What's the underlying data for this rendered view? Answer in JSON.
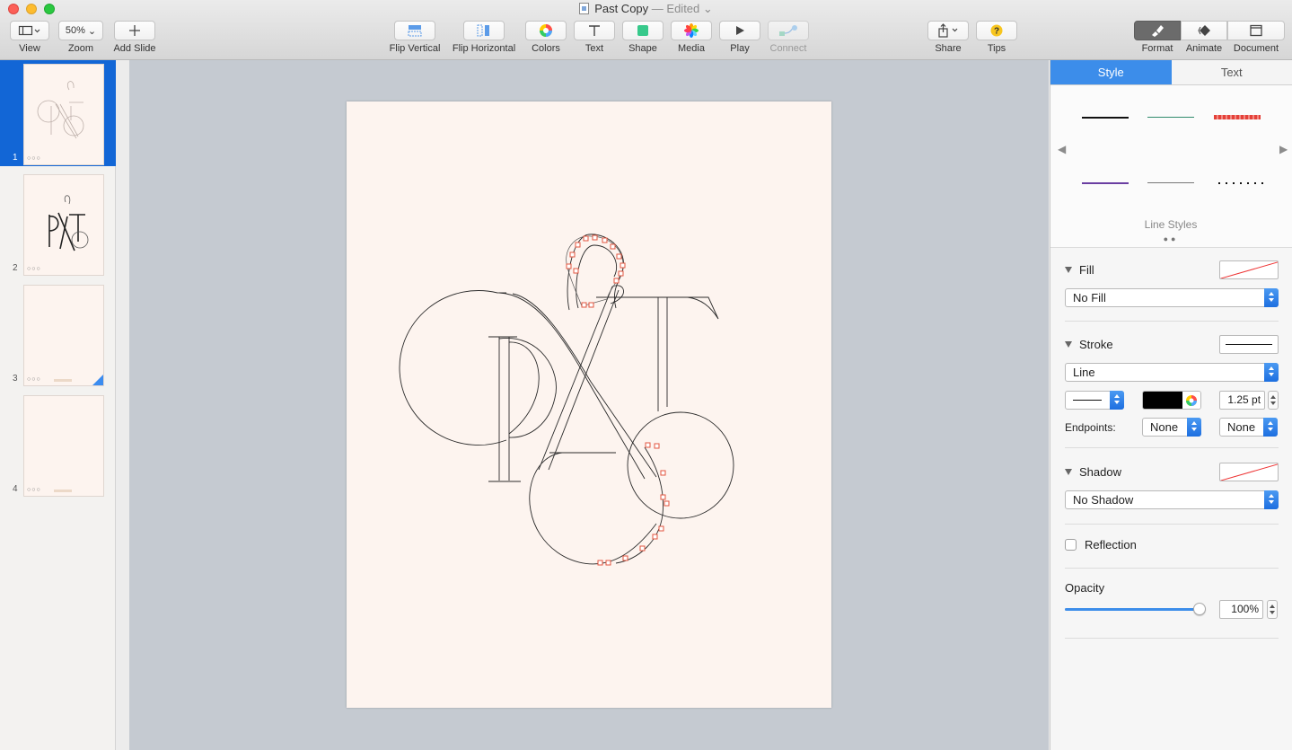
{
  "window": {
    "title": "Past Copy",
    "status": "— Edited"
  },
  "toolbar": {
    "view_label": "View",
    "zoom_value": "50%",
    "zoom_label": "Zoom",
    "add_slide_label": "Add Slide",
    "flip_vertical_label": "Flip Vertical",
    "flip_horizontal_label": "Flip Horizontal",
    "colors_label": "Colors",
    "text_label": "Text",
    "shape_label": "Shape",
    "media_label": "Media",
    "play_label": "Play",
    "connect_label": "Connect",
    "share_label": "Share",
    "tips_label": "Tips",
    "format_label": "Format",
    "animate_label": "Animate",
    "document_label": "Document"
  },
  "navigator": {
    "slides": [
      {
        "number": "1",
        "selected": true
      },
      {
        "number": "2",
        "selected": false
      },
      {
        "number": "3",
        "selected": false
      },
      {
        "number": "4",
        "selected": false
      }
    ]
  },
  "inspector": {
    "tabs": [
      "Style",
      "Text"
    ],
    "active_tab": "Style",
    "line_styles_caption": "Line Styles",
    "fill": {
      "title": "Fill",
      "value": "No Fill"
    },
    "stroke": {
      "title": "Stroke",
      "type": "Line",
      "width": "1.25 pt",
      "endpoints_label": "Endpoints:",
      "endpoint_start": "None",
      "endpoint_end": "None",
      "color": "#000000"
    },
    "shadow": {
      "title": "Shadow",
      "value": "No Shadow"
    },
    "reflection": {
      "label": "Reflection",
      "checked": false
    },
    "opacity": {
      "label": "Opacity",
      "value": "100%",
      "level": 1.0
    }
  },
  "colors": {
    "accent": "#3c8dea",
    "selection": "#1266d6",
    "slide_bg": "#fdf4ef",
    "handle": "#e2553f"
  }
}
